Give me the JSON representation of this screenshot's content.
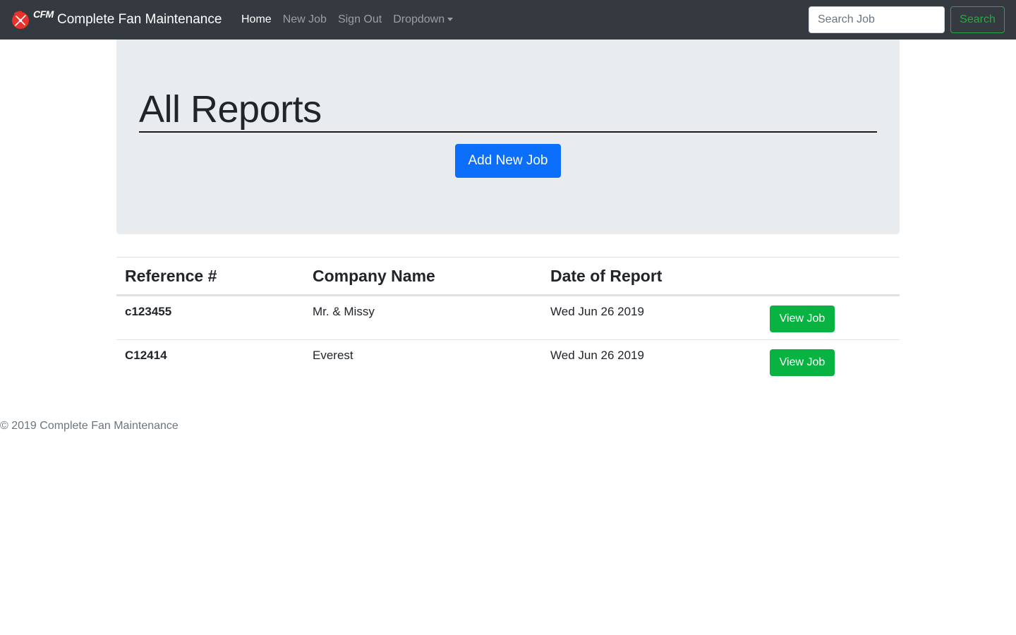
{
  "navbar": {
    "logo_text": "CFM",
    "brand_name": "Complete Fan Maintenance",
    "links": [
      {
        "label": "Home",
        "active": true
      },
      {
        "label": "New Job",
        "active": false
      },
      {
        "label": "Sign Out",
        "active": false
      }
    ],
    "dropdown_label": "Dropdown",
    "search_placeholder": "Search Job",
    "search_value": "",
    "search_button": "Search"
  },
  "jumbotron": {
    "title": "All Reports",
    "add_button": "Add New Job"
  },
  "table": {
    "headers": [
      "Reference #",
      "Company Name",
      "Date of Report",
      ""
    ],
    "rows": [
      {
        "reference": "c123455",
        "company": "Mr. & Missy",
        "date": "Wed Jun 26 2019",
        "action": "View Job"
      },
      {
        "reference": "C12414",
        "company": "Everest",
        "date": "Wed Jun 26 2019",
        "action": "View Job"
      }
    ]
  },
  "footer": {
    "text": "© 2019 Complete Fan Maintenance"
  },
  "colors": {
    "navbar_bg": "#343a40",
    "jumbotron_bg": "#e9ecef",
    "primary": "#0b6ffb",
    "success": "#09b342",
    "outline_success": "#28a745",
    "logo_red": "#e8322b"
  }
}
